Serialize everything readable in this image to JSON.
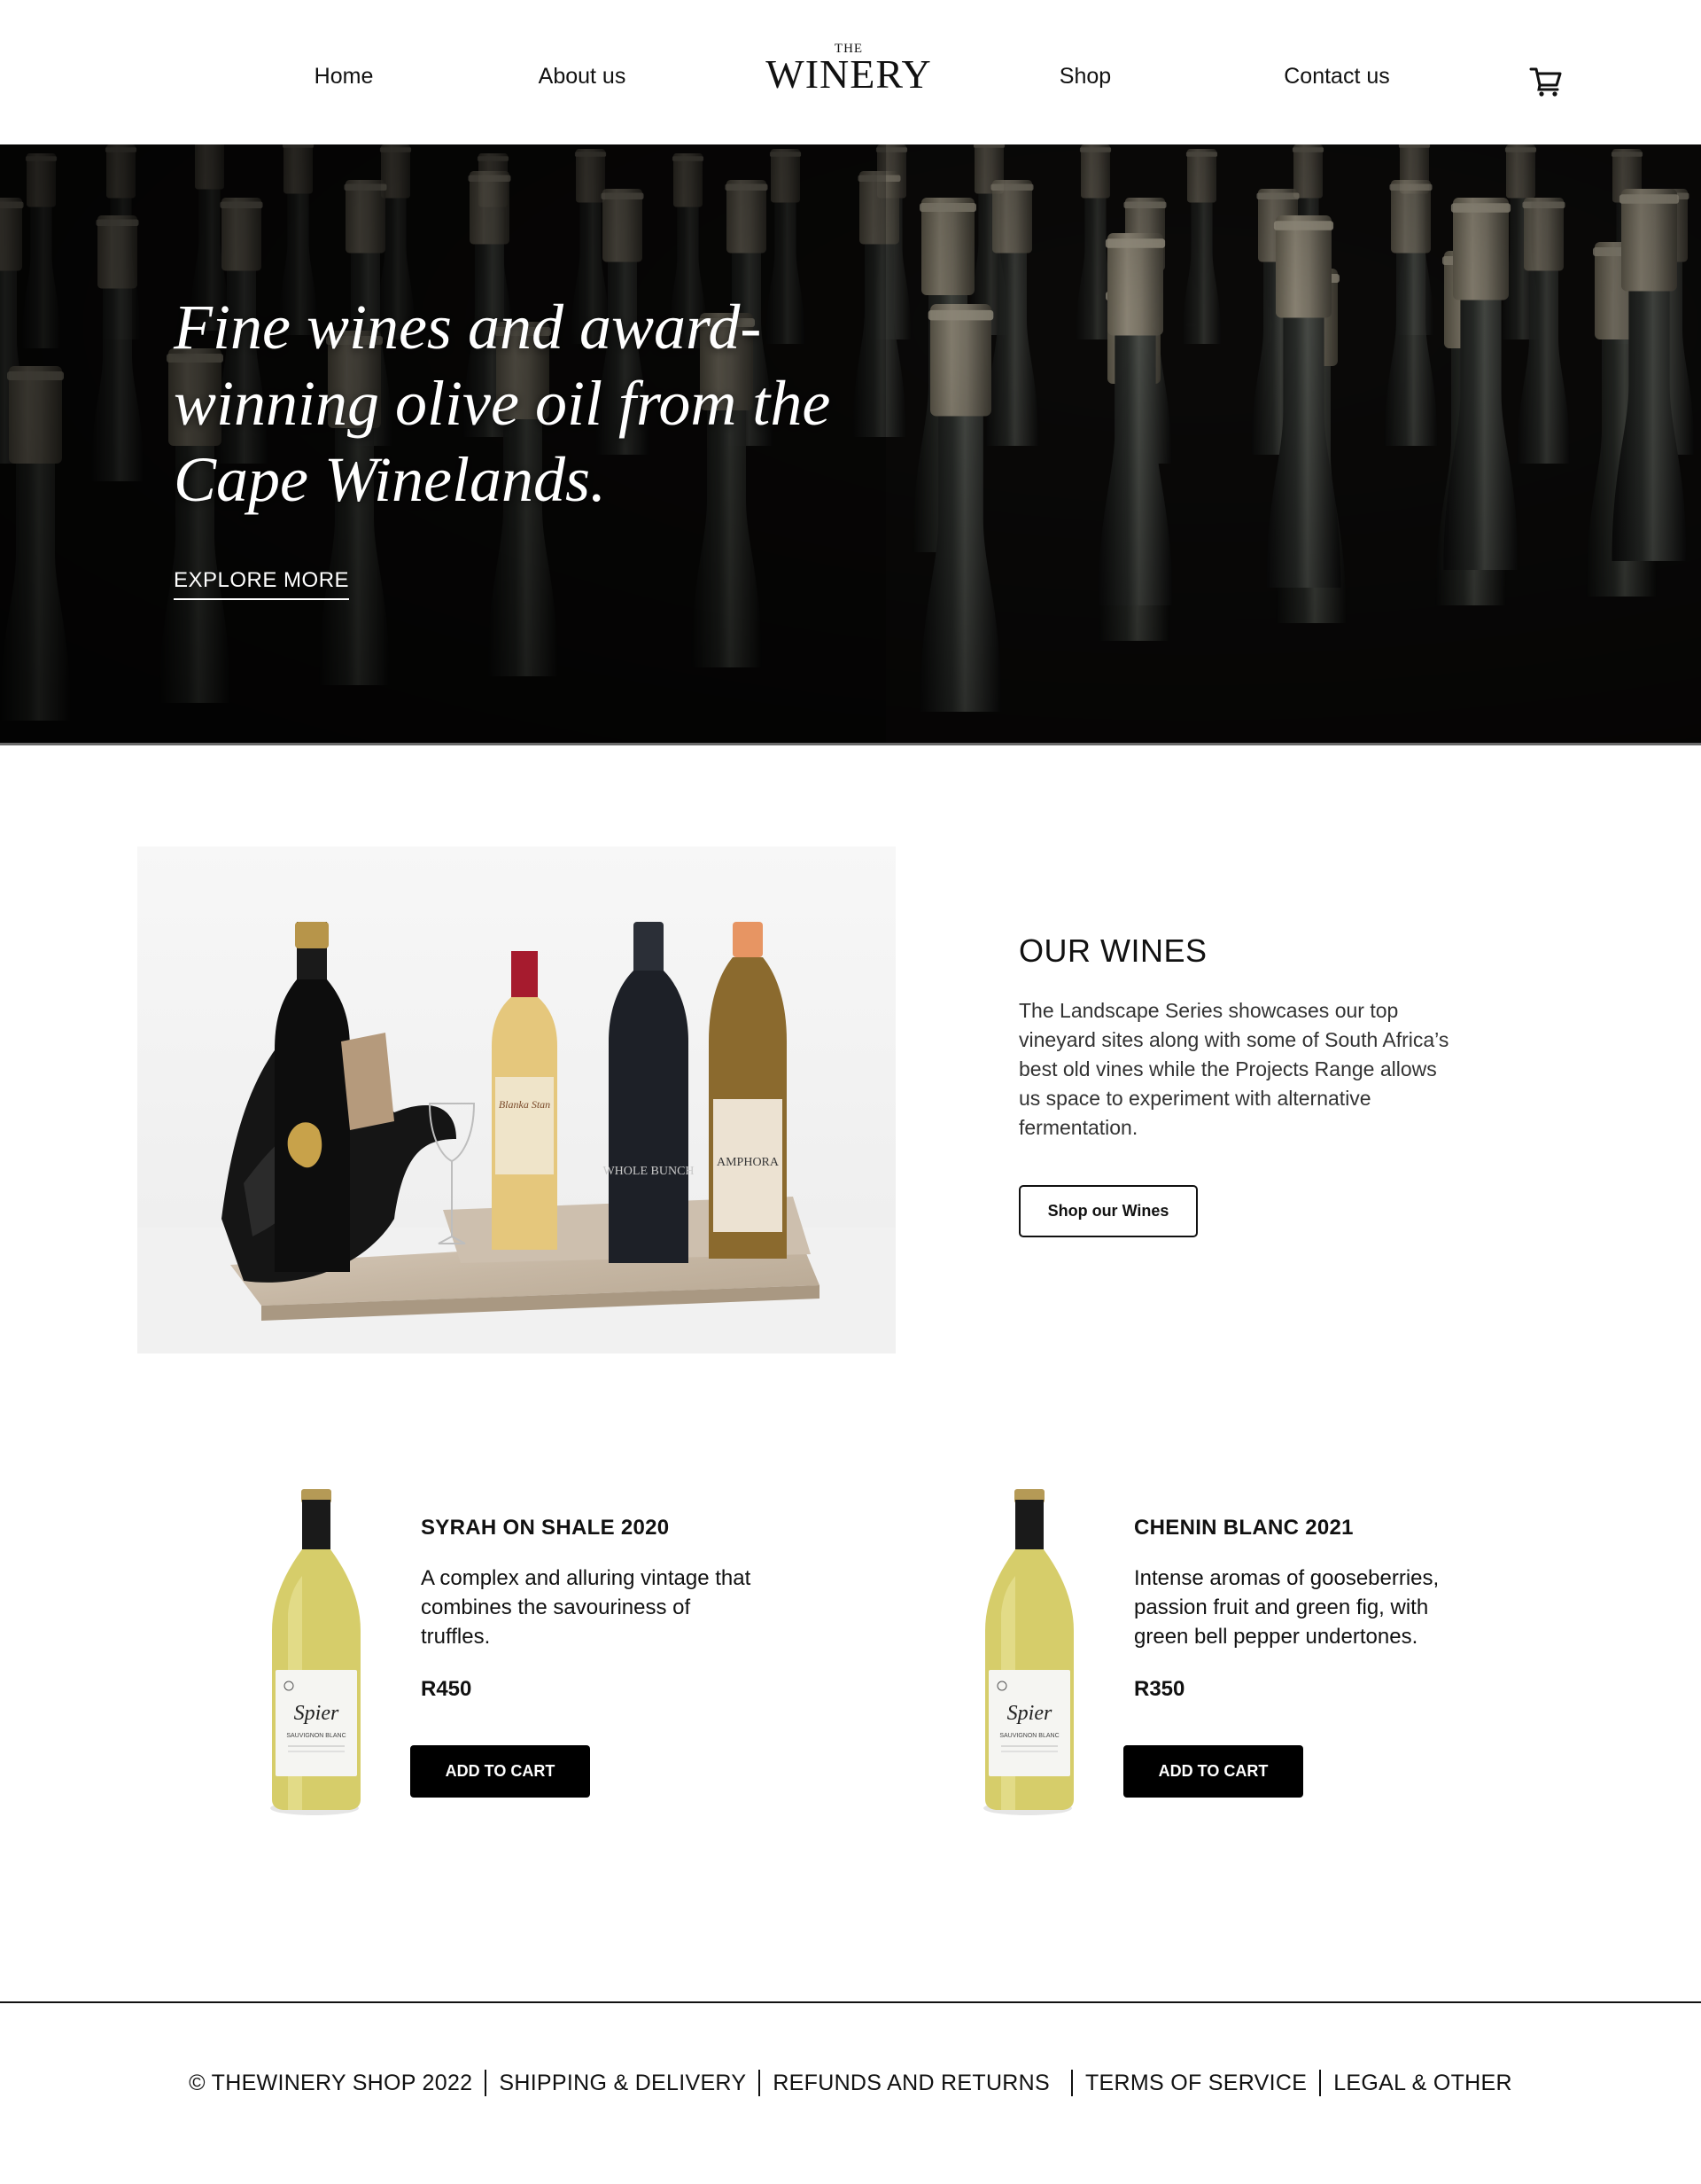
{
  "brand": {
    "logo_small": "THE",
    "logo_big": "WINERY"
  },
  "nav": {
    "home": "Home",
    "about": "About us",
    "shop": "Shop",
    "contact": "Contact us",
    "cart_icon": "shopping-cart-icon"
  },
  "hero": {
    "headline": "Fine wines and award-winning olive oil from the Cape Winelands.",
    "cta": "EXPLORE MORE"
  },
  "our_wines": {
    "title": "OUR WINES",
    "description": "The Landscape Series showcases our top vineyard sites along with some of South Africa’s best old vines while the Projects Range allows us space to experiment with alternative fermentation.",
    "button": "Shop our Wines",
    "bottle_labels": {
      "label_1": "Blanka Stan",
      "label_2": "WHOLE BUNCH",
      "label_3": "AMPHORA"
    }
  },
  "products": [
    {
      "name": "SYRAH ON SHALE 2020",
      "description": "A complex and alluring vintage that combines the savouriness of truffles.",
      "price": "R450",
      "button": "ADD TO CART",
      "label_brand": "Spier",
      "label_variety": "SAUVIGNON BLANC"
    },
    {
      "name": "CHENIN BLANC 2021",
      "description": "Intense aromas of gooseberries, passion fruit and green fig, with green bell pepper undertones.",
      "price": "R350",
      "button": "ADD TO CART",
      "label_brand": "Spier",
      "label_variety": "SAUVIGNON BLANC"
    }
  ],
  "footer": {
    "copyright": "© THEWINERY SHOP 2022",
    "shipping": "SHIPPING & DELIVERY",
    "refunds": "REFUNDS AND RETURNS",
    "terms": "TERMS OF SERVICE",
    "legal": "LEGAL & OTHER"
  },
  "colors": {
    "accent": "#000000",
    "background": "#ffffff",
    "hero_bg": "#0b0a09"
  }
}
